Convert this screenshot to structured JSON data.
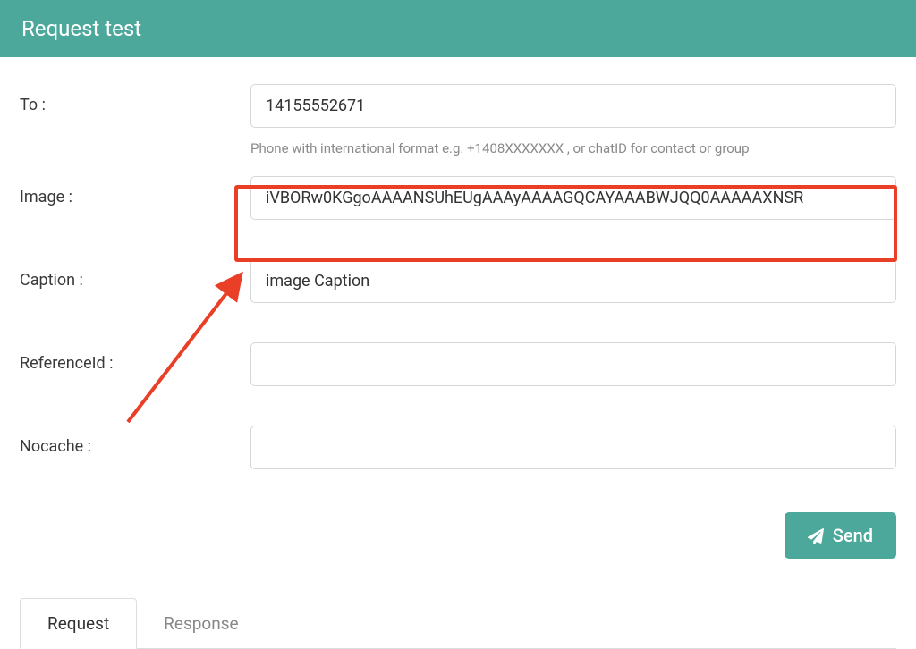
{
  "header": {
    "title": "Request test"
  },
  "form": {
    "to": {
      "label": "To :",
      "value": "14155552671",
      "hint": "Phone with international format e.g. +1408XXXXXXX , or chatID for contact or group"
    },
    "image": {
      "label": "Image :",
      "value": "iVBORw0KGgoAAAANSUhEUgAAAyAAAAGQCAYAAABWJQQ0AAAAAXNSR"
    },
    "caption": {
      "label": "Caption :",
      "value": "image Caption"
    },
    "referenceId": {
      "label": "ReferenceId :",
      "value": ""
    },
    "nocache": {
      "label": "Nocache :",
      "value": ""
    }
  },
  "actions": {
    "send_label": "Send"
  },
  "tabs": {
    "request": "Request",
    "response": "Response"
  }
}
